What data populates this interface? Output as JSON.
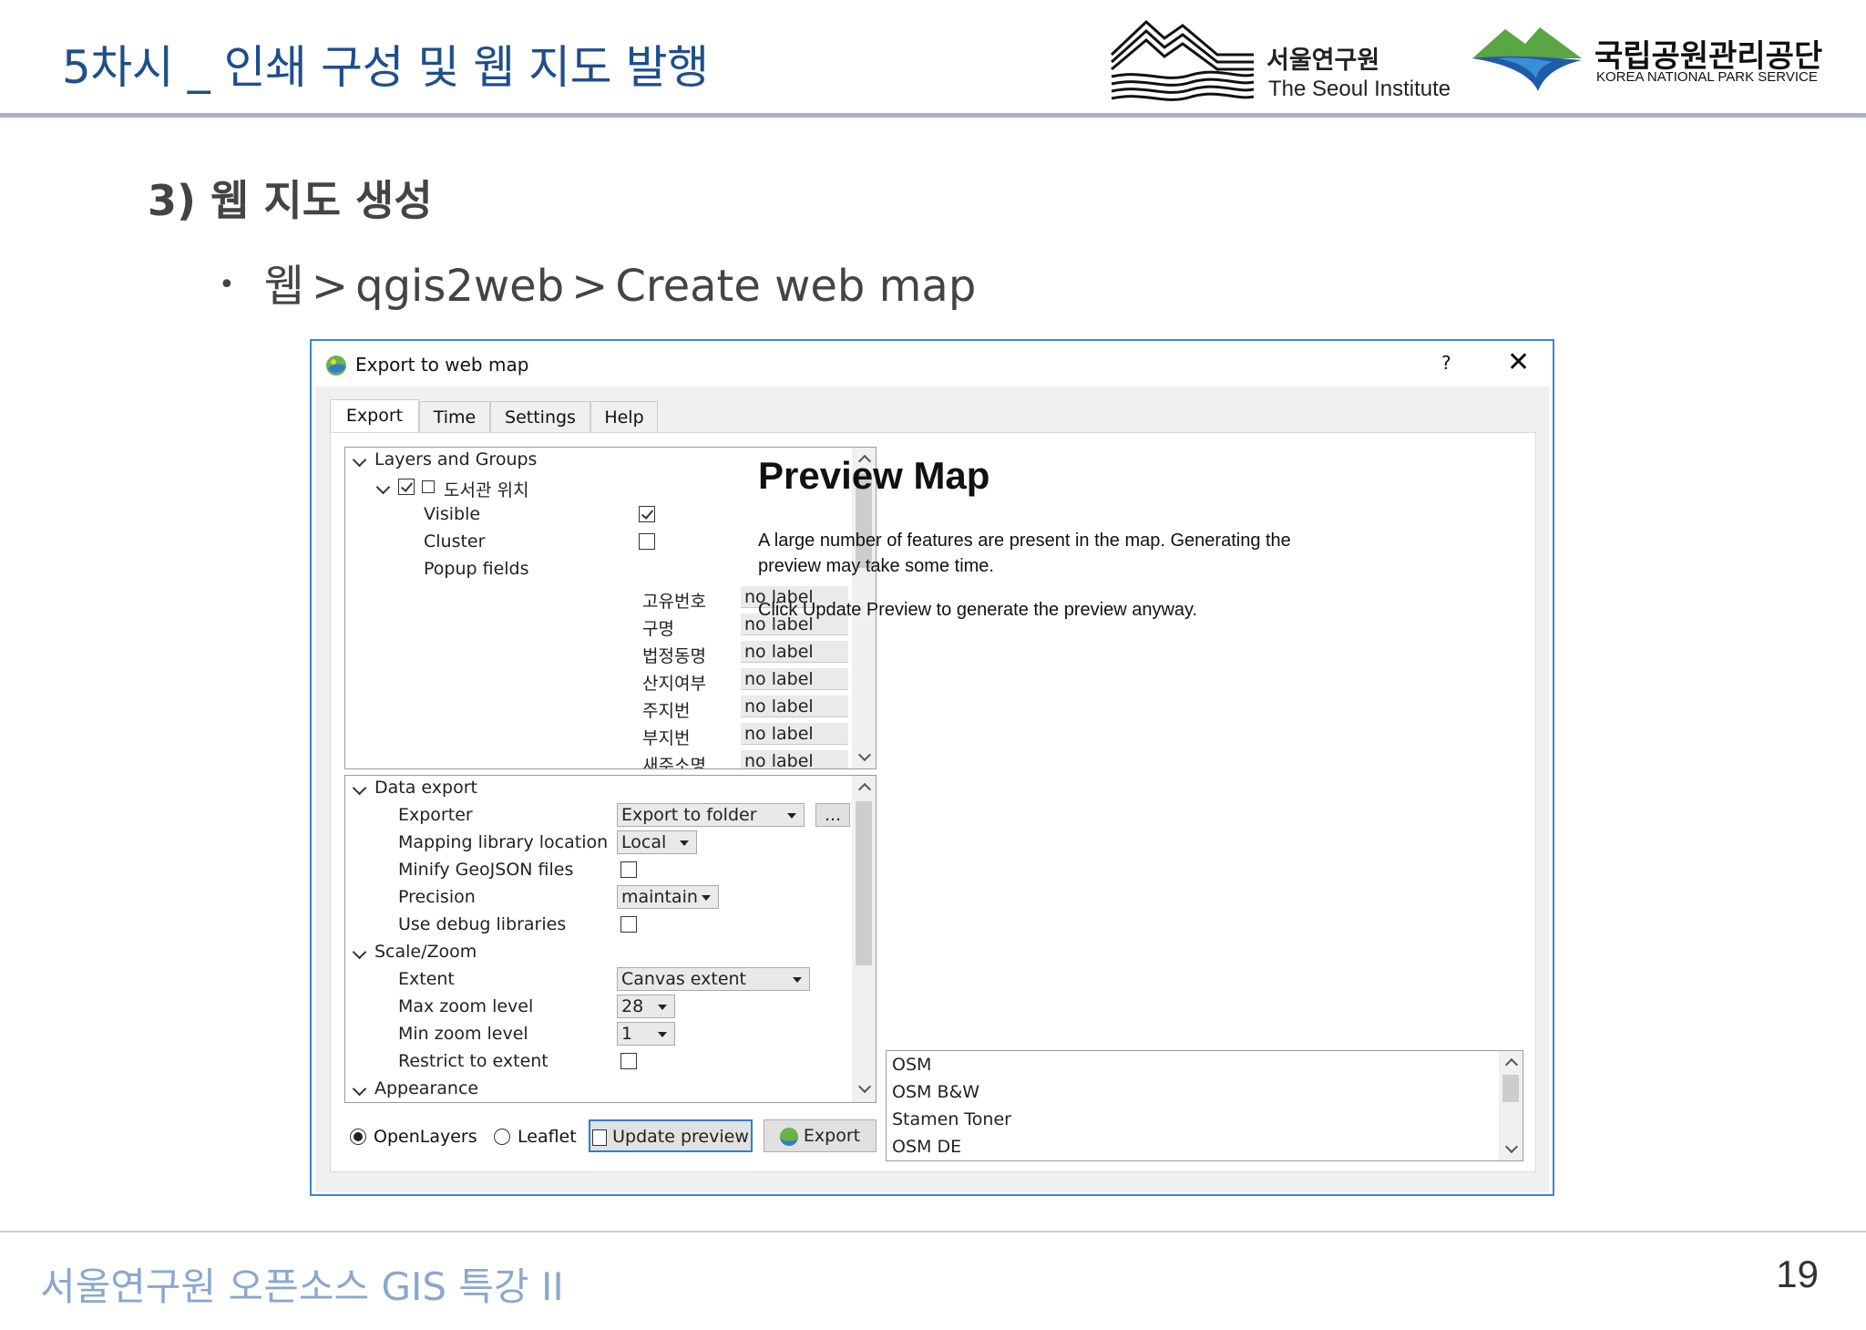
{
  "slide": {
    "title": "5차시 _ 인쇄 구성 및 웹 지도 발행",
    "heading": "3) 웹 지도 생성",
    "bullet": {
      "part1": "웹",
      "part2": "qgis2web",
      "part3": "Create web map",
      "separator": ">"
    },
    "footer": "서울연구원 오픈소스 GIS 특강 II",
    "page_number": "19"
  },
  "logos": {
    "seoul_ko": "서울연구원",
    "seoul_en": "The Seoul Institute",
    "knps_ko": "국립공원관리공단",
    "knps_en": "KOREA NATIONAL PARK SERVICE"
  },
  "dialog": {
    "title": "Export to web map",
    "help": "?",
    "close": "✕",
    "tabs": [
      "Export",
      "Time",
      "Settings",
      "Help"
    ],
    "layers": {
      "header": "Layers and Groups",
      "layer_name": "도서관 위치",
      "visible": "Visible",
      "cluster": "Cluster",
      "popup_fields": "Popup fields",
      "fields": [
        {
          "name": "고유번호",
          "value": "no label"
        },
        {
          "name": "구명",
          "value": "no label"
        },
        {
          "name": "법정동명",
          "value": "no label"
        },
        {
          "name": "산지여부",
          "value": "no label"
        },
        {
          "name": "주지번",
          "value": "no label"
        },
        {
          "name": "부지번",
          "value": "no label"
        },
        {
          "name": "새주소명",
          "value": "no label"
        }
      ]
    },
    "data_export": {
      "header": "Data export",
      "exporter_label": "Exporter",
      "exporter_value": "Export to folder",
      "browse": "...",
      "mapping_label": "Mapping library location",
      "mapping_value": "Local",
      "minify_label": "Minify GeoJSON files",
      "precision_label": "Precision",
      "precision_value": "maintain",
      "debug_label": "Use debug libraries",
      "scale_header": "Scale/Zoom",
      "extent_label": "Extent",
      "extent_value": "Canvas extent",
      "maxzoom_label": "Max zoom level",
      "maxzoom_value": "28",
      "minzoom_label": "Min zoom level",
      "minzoom_value": "1",
      "restrict_label": "Restrict to extent",
      "appearance_header": "Appearance"
    },
    "footer": {
      "openlayers": "OpenLayers",
      "leaflet": "Leaflet",
      "update_preview": "Update preview",
      "export": "Export"
    },
    "preview": {
      "title": "Preview Map",
      "line1": "A large number of features are present in the map. Generating the",
      "line2": "preview may take some time.",
      "line3": "Click Update Preview to generate the preview anyway."
    },
    "basemaps": [
      "OSM",
      "OSM B&W",
      "Stamen Toner",
      "OSM DE"
    ]
  }
}
